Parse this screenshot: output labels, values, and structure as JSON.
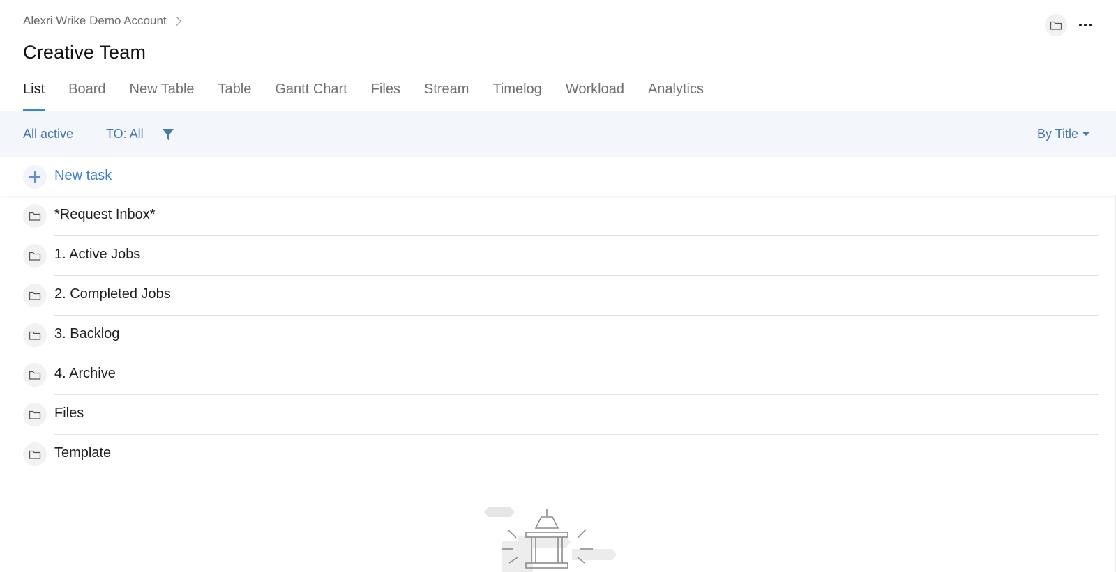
{
  "breadcrumb": {
    "account": "Alexri Wrike Demo Account"
  },
  "page": {
    "title": "Creative Team"
  },
  "tabs": [
    {
      "label": "List",
      "active": true
    },
    {
      "label": "Board",
      "active": false
    },
    {
      "label": "New Table",
      "active": false
    },
    {
      "label": "Table",
      "active": false
    },
    {
      "label": "Gantt Chart",
      "active": false
    },
    {
      "label": "Files",
      "active": false
    },
    {
      "label": "Stream",
      "active": false
    },
    {
      "label": "Timelog",
      "active": false
    },
    {
      "label": "Workload",
      "active": false
    },
    {
      "label": "Analytics",
      "active": false
    }
  ],
  "filters": {
    "status": "All active",
    "assignee": "TO: All",
    "sort": "By Title"
  },
  "new_task": {
    "label": "New task"
  },
  "folders": [
    {
      "label": "*Request Inbox*"
    },
    {
      "label": "1. Active Jobs"
    },
    {
      "label": "2. Completed Jobs"
    },
    {
      "label": "3. Backlog"
    },
    {
      "label": "4. Archive"
    },
    {
      "label": "Files"
    },
    {
      "label": "Template"
    }
  ],
  "colors": {
    "accent": "#3b82e0",
    "link": "#4a78a8",
    "filterbar_bg": "#f3f6fb"
  },
  "icons": {
    "top_folder": "folder-icon",
    "more": "more-icon",
    "filter": "filter-icon",
    "add": "plus-icon",
    "folder_rows": "folder-icon"
  }
}
